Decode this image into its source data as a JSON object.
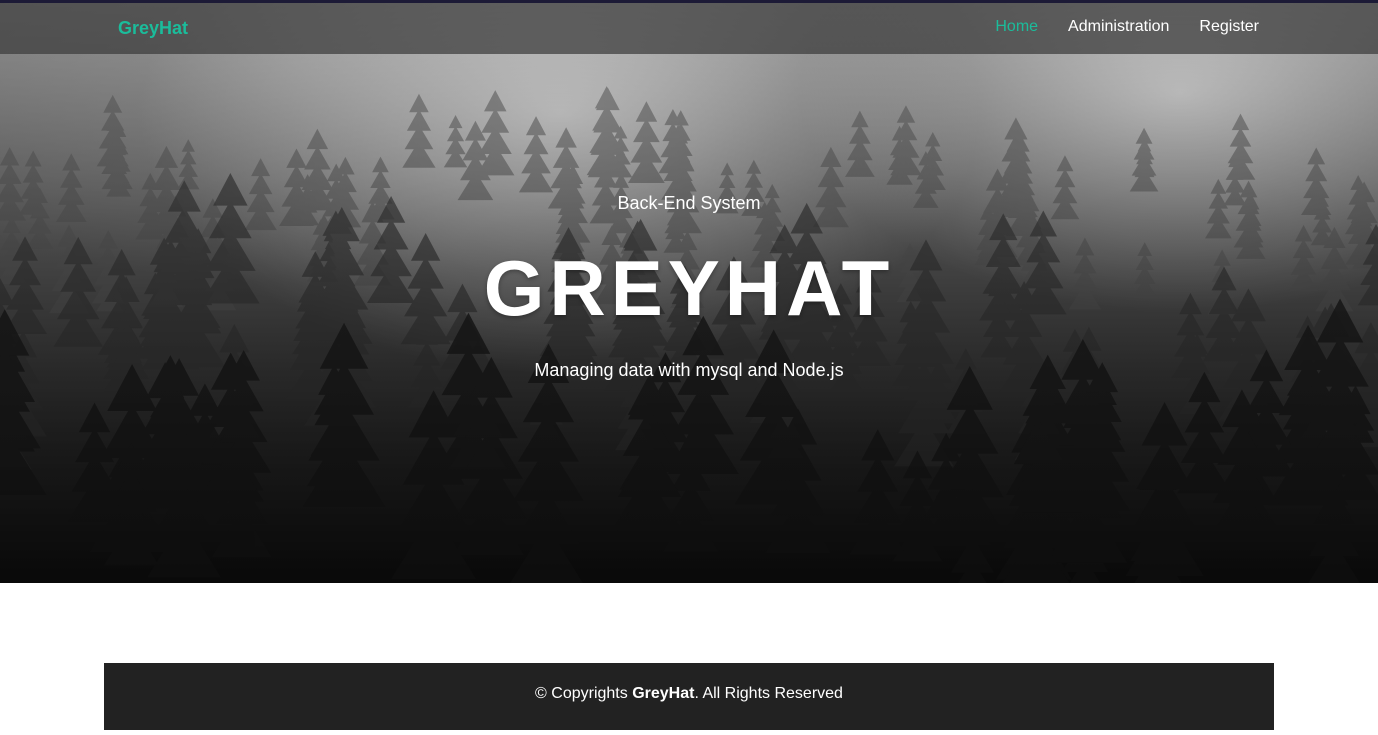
{
  "nav": {
    "brand": "GreyHat",
    "items": [
      {
        "label": "Home",
        "active": true
      },
      {
        "label": "Administration",
        "active": false
      },
      {
        "label": "Register",
        "active": false
      }
    ]
  },
  "hero": {
    "subtitle": "Back-End System",
    "title": "GREYHAT",
    "tagline": "Managing data with mysql and Node.js"
  },
  "footer": {
    "prefix": "© Copyrights ",
    "brand": "GreyHat",
    "suffix": ". All Rights Reserved"
  },
  "colors": {
    "accent": "#1bbc9b",
    "navbar": "#3c3c3c",
    "footer": "#222222",
    "topline": "#1c1a36"
  }
}
